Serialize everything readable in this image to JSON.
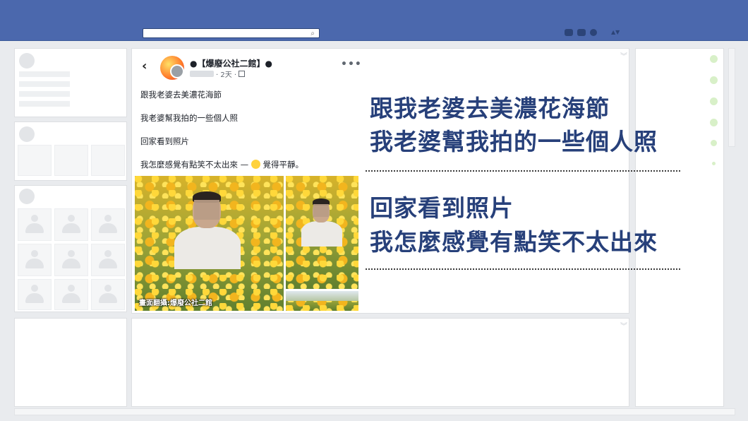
{
  "header": {
    "search_icon": "search-icon",
    "account_label": "▲▼"
  },
  "post": {
    "page_name": "●【爆廢公社二館】●",
    "time": "· 2天 ·",
    "lines": [
      "跟我老婆去美濃花海節",
      "我老婆幫我拍的一些個人照",
      "回家看到照片",
      "我怎麼感覺有點笑不太出來 — "
    ],
    "feeling": "覺得平靜。",
    "more_label": "•••",
    "photo_caption": "畫面翻攝:爆廢公社二館"
  },
  "overlay": {
    "line1": "跟我老婆去美濃花海節",
    "line2": "我老婆幫我拍的一些個人照",
    "line3": "回家看到照片",
    "line4": "我怎麼感覺有點笑不太出來"
  },
  "colors": {
    "topbar": "#4b68ad",
    "overlay_text": "#27407a"
  }
}
